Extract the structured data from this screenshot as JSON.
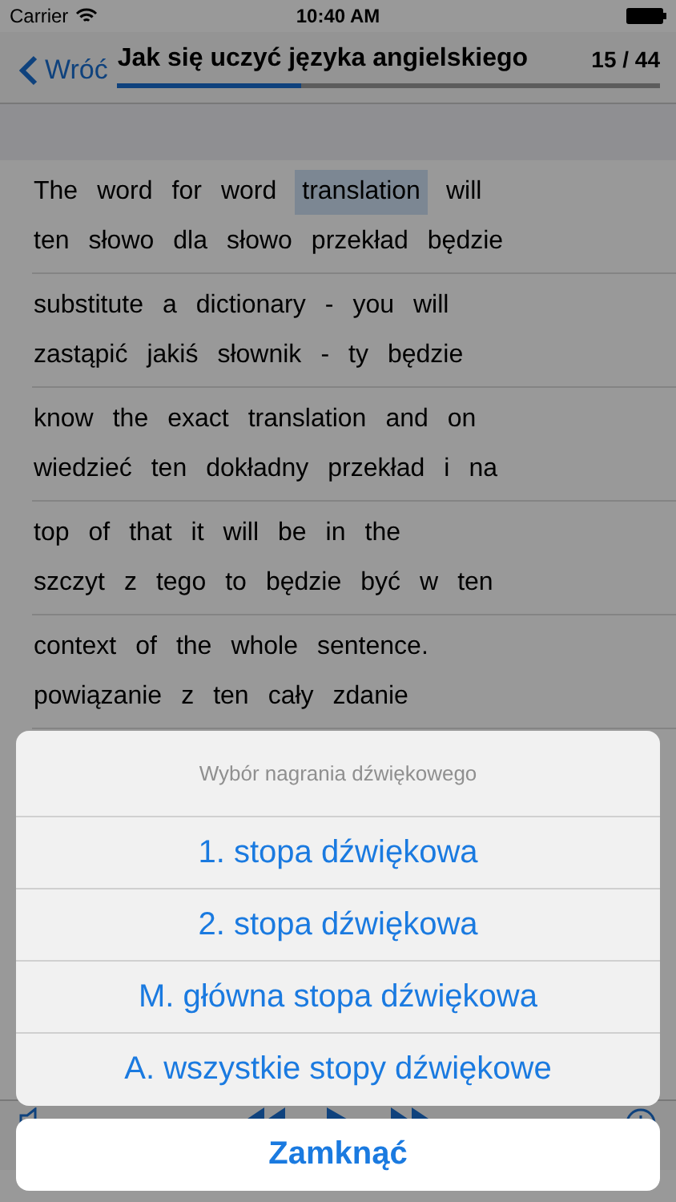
{
  "status_bar": {
    "carrier": "Carrier",
    "time": "10:40 AM"
  },
  "nav": {
    "back": "Wróć",
    "title": "Jak się uczyć języka angielskiego",
    "counter": "15 / 44",
    "level": 0.34
  },
  "sentences": [
    {
      "english": [
        {
          "text": "The",
          "selected": false
        },
        {
          "text": "word",
          "selected": false
        },
        {
          "text": "for",
          "selected": false
        },
        {
          "text": "word",
          "selected": false
        },
        {
          "text": "translation",
          "selected": true
        },
        {
          "text": "will",
          "selected": false
        }
      ],
      "polish": [
        "ten",
        "słowo",
        "dla",
        "słowo",
        "przekład",
        "będzie"
      ]
    },
    {
      "english": [
        {
          "text": "substitute",
          "selected": false
        },
        {
          "text": "a",
          "selected": false
        },
        {
          "text": "dictionary",
          "selected": false
        },
        {
          "text": "-",
          "selected": false
        },
        {
          "text": "you",
          "selected": false
        },
        {
          "text": "will",
          "selected": false
        }
      ],
      "polish": [
        "zastąpić",
        "jakiś",
        "słownik",
        "-",
        "ty",
        "będzie"
      ]
    },
    {
      "english": [
        {
          "text": "know",
          "selected": false
        },
        {
          "text": "the",
          "selected": false
        },
        {
          "text": "exact",
          "selected": false
        },
        {
          "text": "translation",
          "selected": false
        },
        {
          "text": "and",
          "selected": false
        },
        {
          "text": "on",
          "selected": false
        }
      ],
      "polish": [
        "wiedzieć",
        "ten",
        "dokładny",
        "przekład",
        "i",
        "na"
      ]
    },
    {
      "english": [
        {
          "text": "top",
          "selected": false
        },
        {
          "text": "of",
          "selected": false
        },
        {
          "text": "that",
          "selected": false
        },
        {
          "text": "it",
          "selected": false
        },
        {
          "text": "will",
          "selected": false
        },
        {
          "text": "be",
          "selected": false
        },
        {
          "text": "in",
          "selected": false
        },
        {
          "text": "the",
          "selected": false
        }
      ],
      "polish": [
        "szczyt",
        "z",
        "tego",
        "to",
        "będzie",
        "być",
        "w",
        "ten"
      ]
    },
    {
      "english": [
        {
          "text": "context",
          "selected": false
        },
        {
          "text": "of",
          "selected": false
        },
        {
          "text": "the",
          "selected": false
        },
        {
          "text": "whole",
          "selected": false
        },
        {
          "text": "sentence.",
          "selected": false
        }
      ],
      "polish": [
        "powiązanie",
        "z",
        "ten",
        "cały",
        "zdanie"
      ]
    }
  ],
  "action_sheet": {
    "title": "Wybór nagrania dźwiękowego",
    "options": [
      "1. stopa dźwiękowa",
      "2. stopa dźwiękowa",
      "M. główna stopa dźwiękowa",
      "A. wszystkie stopy dźwiękowe"
    ],
    "cancel": "Zamknąć"
  }
}
